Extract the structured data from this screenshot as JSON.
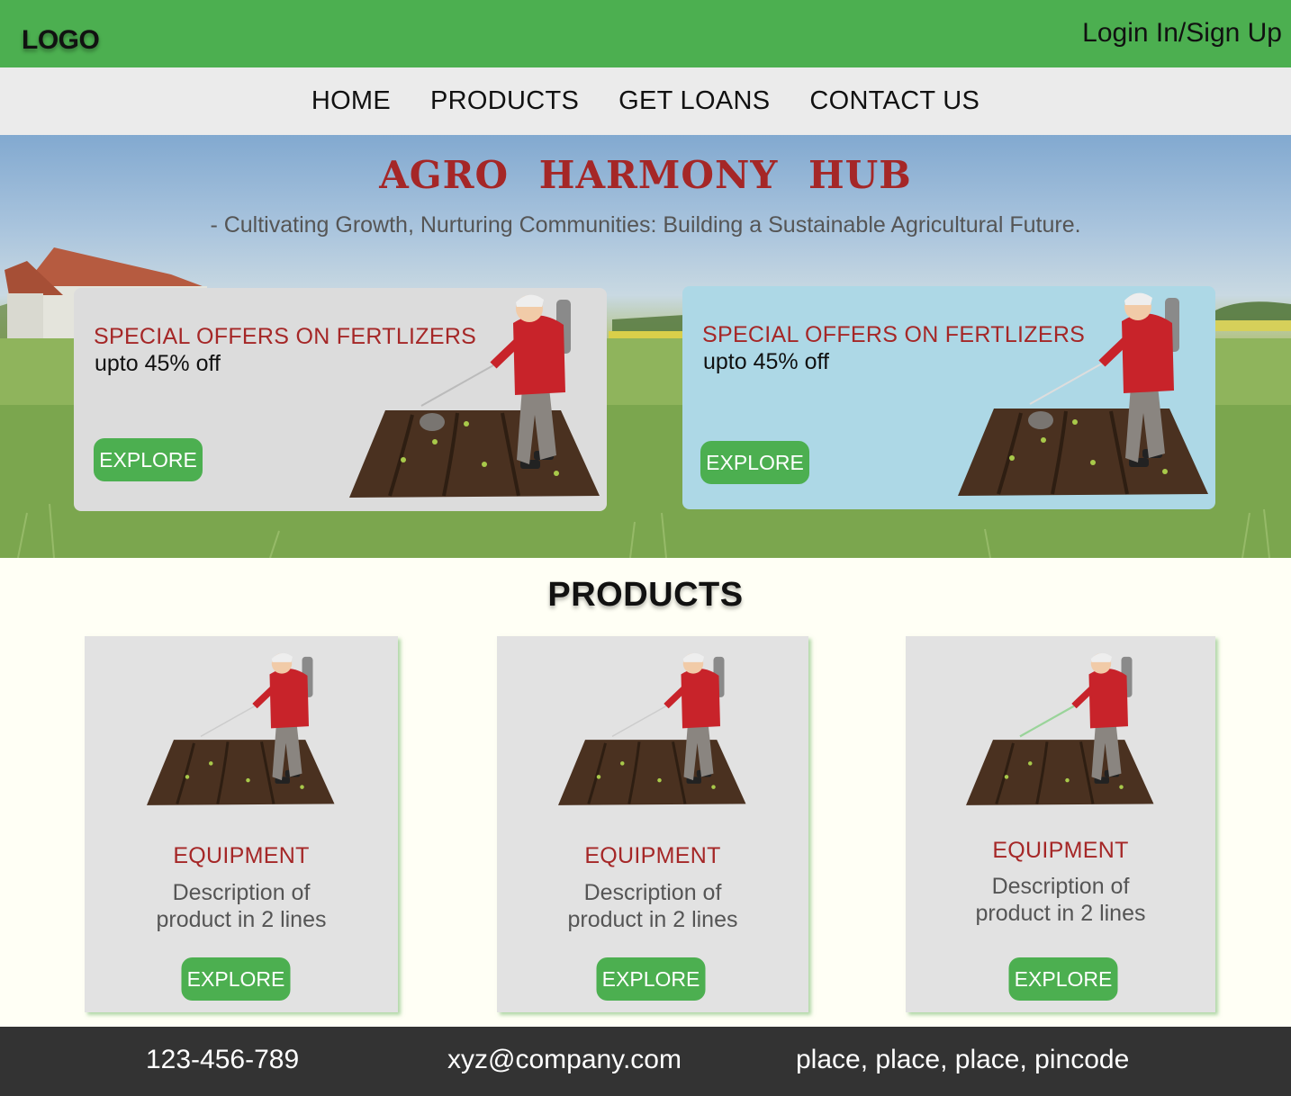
{
  "header": {
    "logo": "LOGO",
    "login_label": "Login In/Sign Up"
  },
  "nav": {
    "items": [
      "HOME",
      "PRODUCTS",
      "GET LOANS",
      "CONTACT US"
    ]
  },
  "hero": {
    "title": "AGRO HARMONY HUB",
    "subtitle": "- Cultivating Growth, Nurturing Communities: Building a Sustainable Agricultural Future."
  },
  "offers": [
    {
      "title": "SPECIAL OFFERS ON FERTLIZERS",
      "subtitle": "upto 45% off",
      "button": "EXPLORE",
      "background": "#dcdcdc"
    },
    {
      "title": "SPECIAL OFFERS ON FERTLIZERS",
      "subtitle": "upto 45% off",
      "button": "EXPLORE",
      "background": "#add8e6"
    }
  ],
  "products": {
    "heading": "PRODUCTS",
    "cards": [
      {
        "title": "EQUIPMENT",
        "desc_line1": "Description of",
        "desc_line2": "product in 2 lines",
        "button": "EXPLORE"
      },
      {
        "title": "EQUIPMENT",
        "desc_line1": "Description of",
        "desc_line2": "product in 2 lines",
        "button": "EXPLORE"
      },
      {
        "title": "EQUIPMENT",
        "desc_line1": "Description of",
        "desc_line2": "product in 2 lines",
        "button": "EXPLORE"
      }
    ]
  },
  "footer": {
    "phone": "123-456-789",
    "email": "xyz@company.com",
    "address": "place, place, place, pincode"
  },
  "colors": {
    "brand_green": "#4caf50",
    "accent_red": "#a52727",
    "nav_bg": "#ebebeb",
    "footer_bg": "#333333"
  }
}
